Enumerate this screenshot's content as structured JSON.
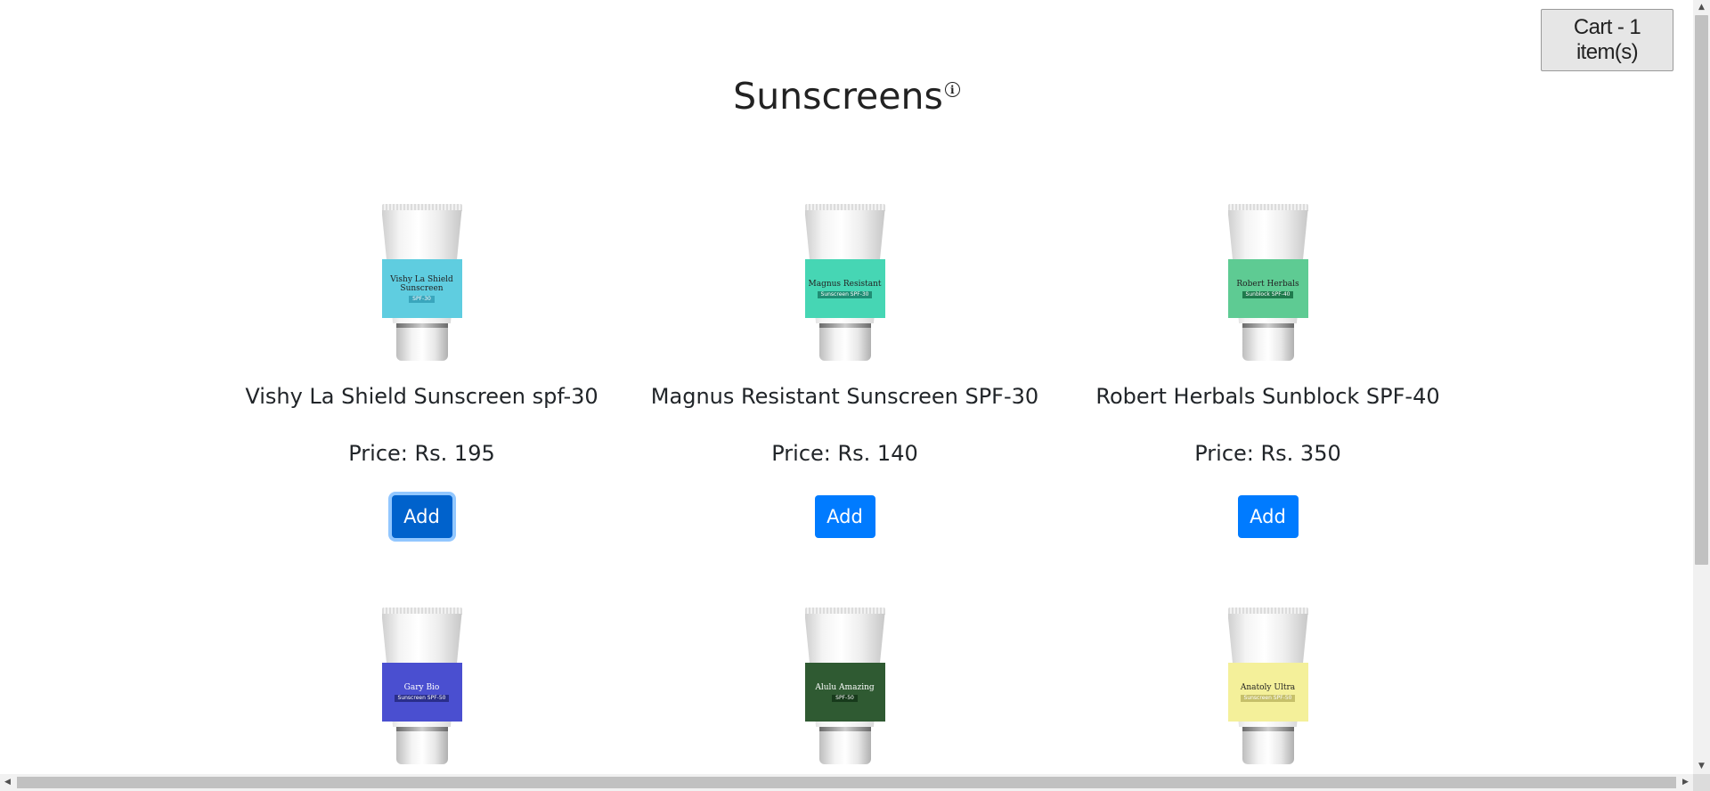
{
  "header": {
    "title": "Sunscreens",
    "info_icon": "i",
    "cart_label": "Cart - 1 item(s)"
  },
  "products": [
    {
      "name": "Vishy La Shield Sunscreen spf-30",
      "price": "Price: Rs. 195",
      "add_label": "Add",
      "label_line1": "Vishy La Shield",
      "label_line2": "Sunscreen",
      "label_tag": "SPF-30",
      "label_color": "#5fcde0",
      "tag_color": "#3aa6bd"
    },
    {
      "name": "Magnus Resistant Sunscreen SPF-30",
      "price": "Price: Rs. 140",
      "add_label": "Add",
      "label_line1": "Magnus Resistant",
      "label_line2": "",
      "label_tag": "Sunscreen SPF-30",
      "label_color": "#46d6b4",
      "tag_color": "#1f8d74"
    },
    {
      "name": "Robert Herbals Sunblock SPF-40",
      "price": "Price: Rs. 350",
      "add_label": "Add",
      "label_line1": "Robert Herbals",
      "label_line2": "",
      "label_tag": "Sunblock SPF-40",
      "label_color": "#5ecb93",
      "tag_color": "#1f7a4d"
    },
    {
      "name": "",
      "price": "",
      "add_label": "",
      "label_line1": "Gary Bio",
      "label_line2": "",
      "label_tag": "Sunscreen SPF-50",
      "label_color": "#4a4fd0",
      "tag_color": "#2a2e8a"
    },
    {
      "name": "",
      "price": "",
      "add_label": "",
      "label_line1": "Alulu Amazing",
      "label_line2": "",
      "label_tag": "SPF-50",
      "label_color": "#2f5a32",
      "tag_color": "#173a1b"
    },
    {
      "name": "",
      "price": "",
      "add_label": "",
      "label_line1": "Anatoly Ultra",
      "label_line2": "",
      "label_tag": "Sunscreen SPF-50",
      "label_color": "#f4f09a",
      "tag_color": "#c6c06a"
    }
  ],
  "scrollbars": {
    "up_icon": "▲",
    "down_icon": "▼",
    "left_icon": "◀",
    "right_icon": "▶"
  }
}
